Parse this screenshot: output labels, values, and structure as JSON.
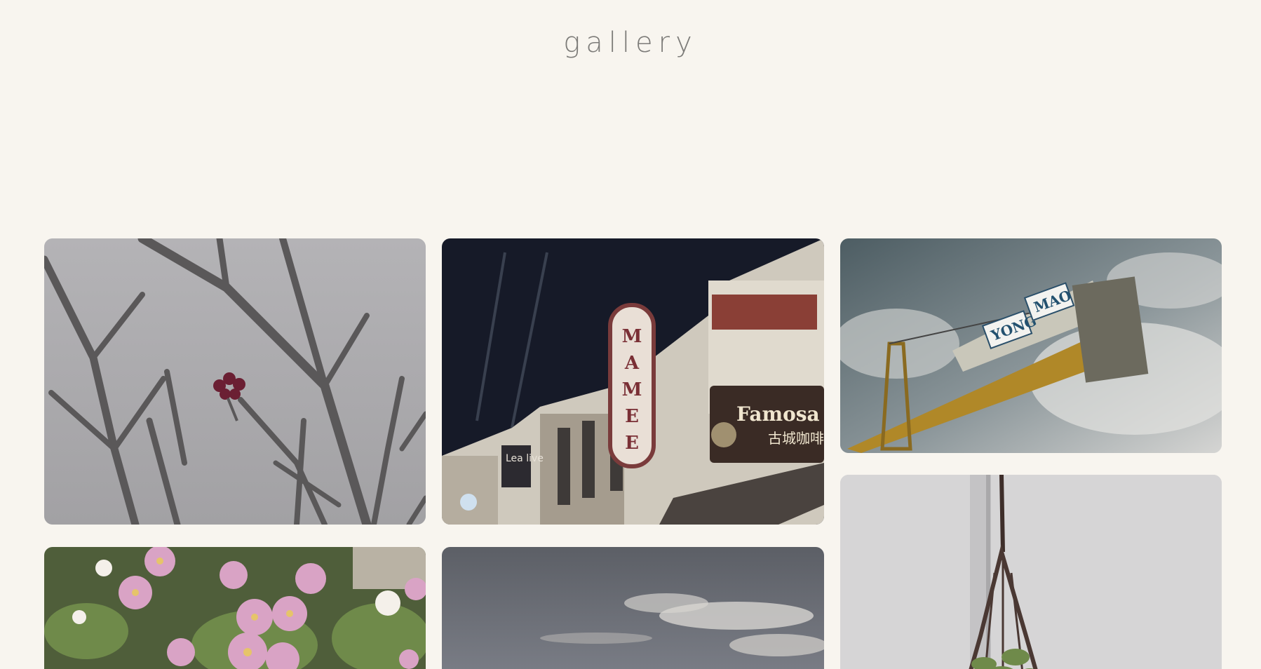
{
  "header": {
    "title": "gallery"
  },
  "gallery": {
    "items": [
      {
        "subject": "bare-branches-flower"
      },
      {
        "subject": "night-street-signs",
        "signs": {
          "vertical": "MAMEE",
          "shop": "Famosa Kopi",
          "shop_cjk": "古城咖啡店",
          "small": "Lea live"
        }
      },
      {
        "subject": "crane",
        "signs": {
          "left": "YONG",
          "right": "MAO"
        }
      },
      {
        "subject": "pink-daisies"
      },
      {
        "subject": "cloudy-sky"
      },
      {
        "subject": "hanging-basket"
      }
    ]
  },
  "colors": {
    "background": "#f8f5ef",
    "title": "#7c7b78"
  }
}
